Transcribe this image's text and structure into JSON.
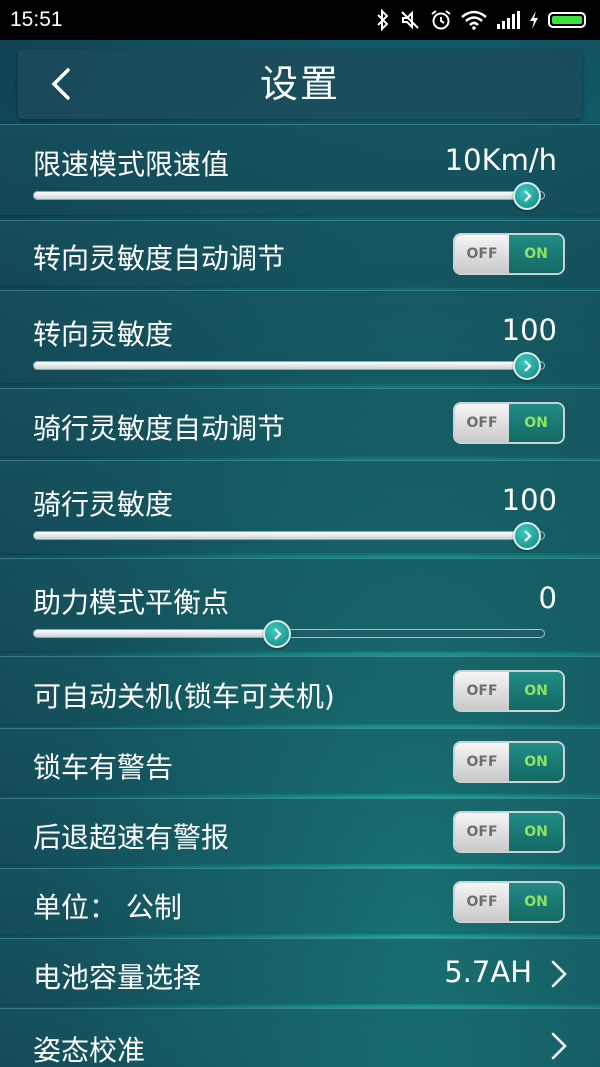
{
  "status_bar": {
    "time": "15:51",
    "icons": [
      "bluetooth-icon",
      "mute-icon",
      "alarm-icon",
      "wifi-icon",
      "signal-icon",
      "charging-icon",
      "battery-icon"
    ],
    "battery_color": "#39e23c"
  },
  "header": {
    "title": "设置",
    "back_icon": "chevron-left-icon"
  },
  "settings": {
    "speed_limit": {
      "label": "限速模式限速值",
      "value": "10Km/h",
      "slider_fraction": 1.0
    },
    "steer_auto": {
      "label": "转向灵敏度自动调节",
      "off_label": "OFF",
      "on_label": "ON"
    },
    "steer_sens": {
      "label": "转向灵敏度",
      "value": "100",
      "slider_fraction": 1.0
    },
    "ride_auto": {
      "label": "骑行灵敏度自动调节",
      "off_label": "OFF",
      "on_label": "ON"
    },
    "ride_sens": {
      "label": "骑行灵敏度",
      "value": "100",
      "slider_fraction": 1.0
    },
    "balance": {
      "label": "助力模式平衡点",
      "value": "0",
      "slider_fraction": 0.48
    },
    "auto_off": {
      "label": "可自动关机(锁车可关机)",
      "off_label": "OFF",
      "on_label": "ON"
    },
    "lock_alarm": {
      "label": "锁车有警告",
      "off_label": "OFF",
      "on_label": "ON"
    },
    "reverse_alarm": {
      "label": "后退超速有警报",
      "off_label": "OFF",
      "on_label": "ON"
    },
    "unit": {
      "label": "单位：  公制",
      "off_label": "OFF",
      "on_label": "ON"
    },
    "battery": {
      "label": "电池容量选择",
      "value": "5.7AH"
    },
    "calibration": {
      "label": "姿态校准"
    }
  },
  "colors": {
    "accent": "#1a9a92",
    "toggle_on_text": "#8fe35f"
  }
}
